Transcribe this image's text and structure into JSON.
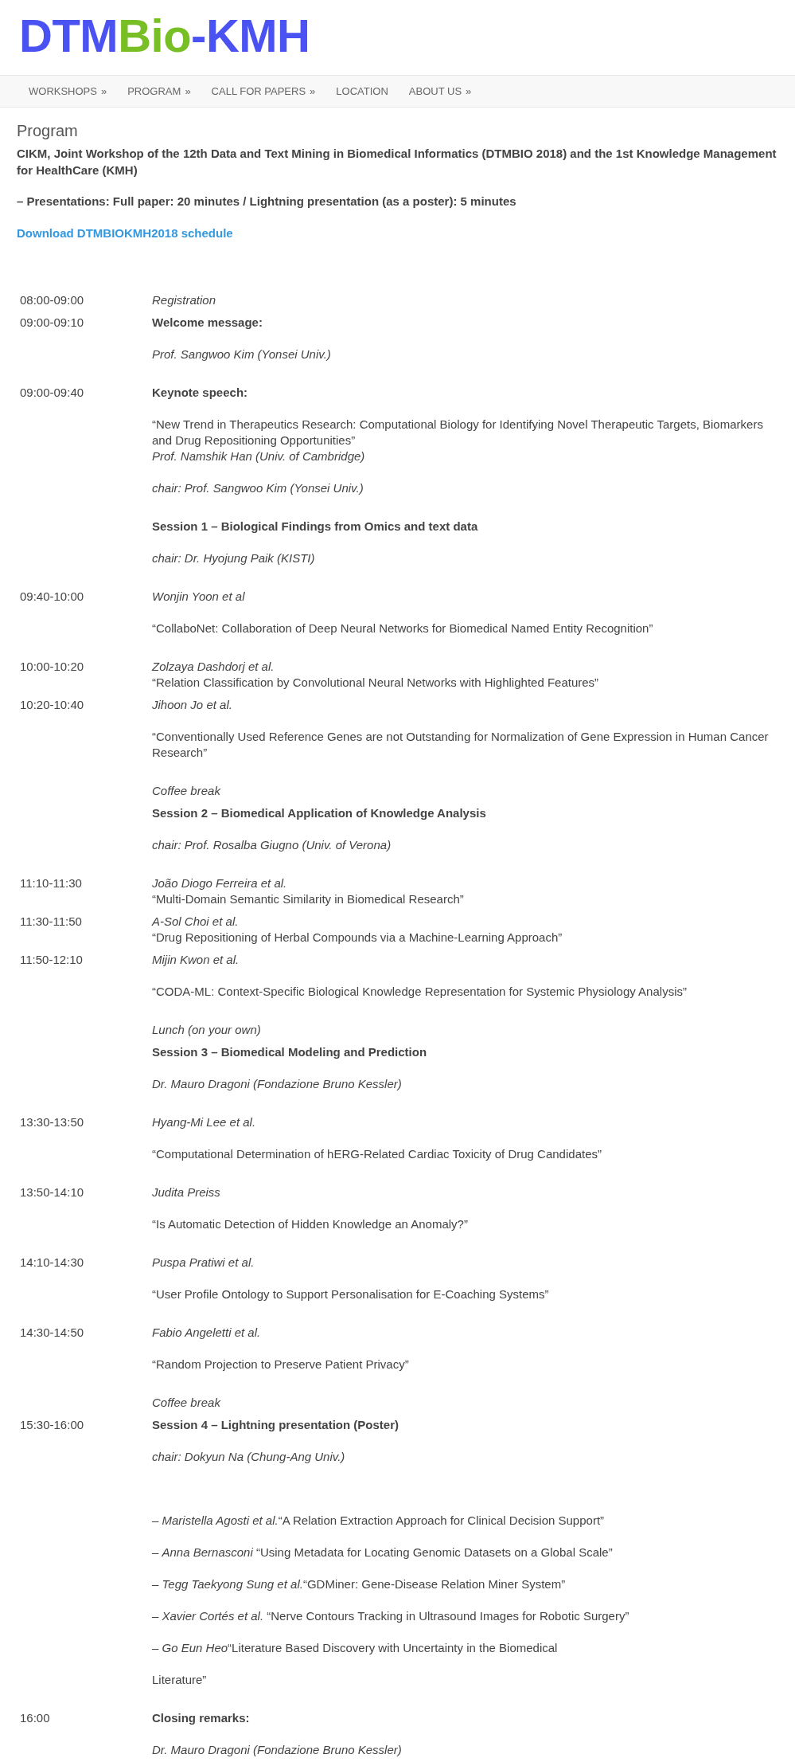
{
  "site": {
    "logo": [
      {
        "text": "DTM",
        "color": "#4a52f2"
      },
      {
        "text": "Bio",
        "color": "#78be25"
      },
      {
        "text": "-KMH",
        "color": "#4a52f2"
      }
    ]
  },
  "nav": {
    "items": [
      {
        "label": "WORKSHOPS",
        "arrow": "»"
      },
      {
        "label": "PROGRAM",
        "arrow": "»"
      },
      {
        "label": "CALL FOR PAPERS",
        "arrow": "»"
      },
      {
        "label": "LOCATION"
      },
      {
        "label": "ABOUT US",
        "arrow": "»"
      }
    ]
  },
  "page": {
    "title": "Program",
    "intro": "CIKM, Joint Workshop of the 12th Data and Text Mining in Biomedical Informatics (DTMBIO 2018) and the 1st Knowledge Management for HealthCare (KMH)",
    "note": "– Presentations: Full paper: 20 minutes / Lightning presentation (as a poster): 5 minutes",
    "download_link": "Download DTMBIOKMH2018 schedule"
  },
  "schedule": {
    "rows": [
      {
        "time": "08:00-09:00",
        "paragraphs": [
          {
            "lines": [
              {
                "kind": "note",
                "text": "Registration"
              }
            ]
          }
        ]
      },
      {
        "time": "09:00-09:10",
        "paragraphs": [
          {
            "lines": [
              {
                "kind": "heading",
                "text": "Welcome message:"
              }
            ]
          },
          {
            "lines": [
              {
                "kind": "speaker",
                "text": "Prof. Sangwoo Kim (Yonsei Univ.)"
              }
            ]
          }
        ]
      },
      {
        "time": "09:00-09:40",
        "paragraphs": [
          {
            "lines": [
              {
                "kind": "heading",
                "text": "Keynote speech:"
              }
            ]
          },
          {
            "lines": [
              {
                "kind": "paper",
                "text": "“New Trend in Therapeutics Research: Computational Biology for Identifying Novel Therapeutic Targets, Biomarkers and Drug Repositioning Opportunities”"
              },
              {
                "kind": "speaker",
                "text": "Prof. Namshik Han (Univ. of Cambridge)"
              }
            ]
          },
          {
            "lines": [
              {
                "kind": "chair",
                "text": "chair: Prof. Sangwoo Kim (Yonsei Univ.)"
              }
            ]
          }
        ]
      },
      {
        "paragraphs": [
          {
            "lines": [
              {
                "kind": "heading",
                "text": "Session 1 – Biological Findings from Omics and text data"
              }
            ]
          },
          {
            "lines": [
              {
                "kind": "chair",
                "text": "chair: Dr. Hyojung Paik (KISTI)"
              }
            ]
          }
        ]
      },
      {
        "time": "09:40-10:00",
        "paragraphs": [
          {
            "lines": [
              {
                "kind": "speaker",
                "text": "Wonjin Yoon et al"
              }
            ]
          },
          {
            "lines": [
              {
                "kind": "paper",
                "text": "“CollaboNet: Collaboration of Deep Neural Networks for Biomedical Named Entity Recognition”"
              }
            ]
          }
        ]
      },
      {
        "time": "10:00-10:20",
        "paragraphs": [
          {
            "lines": [
              {
                "kind": "speaker",
                "text": "Zolzaya Dashdorj et al."
              },
              {
                "kind": "paper",
                "text": "“Relation Classification by Convolutional Neural Networks with Highlighted Features”"
              }
            ]
          }
        ]
      },
      {
        "time": "10:20-10:40",
        "paragraphs": [
          {
            "lines": [
              {
                "kind": "speaker",
                "text": "Jihoon Jo et al."
              }
            ]
          },
          {
            "lines": [
              {
                "kind": "paper",
                "text": "“Conventionally Used Reference Genes are not Outstanding for Normalization of Gene Expression in Human Cancer Research”"
              }
            ]
          }
        ]
      },
      {
        "paragraphs": [
          {
            "lines": [
              {
                "kind": "note",
                "text": "Coffee break"
              }
            ]
          }
        ]
      },
      {
        "paragraphs": [
          {
            "lines": [
              {
                "kind": "heading",
                "text": "Session 2 – Biomedical Application of Knowledge Analysis"
              }
            ]
          },
          {
            "lines": [
              {
                "kind": "chair",
                "text": "chair: Prof. Rosalba Giugno (Univ. of Verona)"
              }
            ]
          }
        ]
      },
      {
        "time": "11:10-11:30",
        "paragraphs": [
          {
            "lines": [
              {
                "kind": "speaker",
                "text": "João Diogo Ferreira et al."
              },
              {
                "kind": "paper",
                "text": "“Multi-Domain Semantic Similarity in Biomedical Research”"
              }
            ]
          }
        ]
      },
      {
        "time": "11:30-11:50",
        "paragraphs": [
          {
            "lines": [
              {
                "kind": "speaker",
                "text": "A-Sol Choi et al."
              },
              {
                "kind": "paper",
                "text": "“Drug Repositioning of Herbal Compounds via a Machine-Learning Approach”"
              }
            ]
          }
        ]
      },
      {
        "time": "11:50-12:10",
        "paragraphs": [
          {
            "lines": [
              {
                "kind": "speaker",
                "text": "Mijin Kwon et al."
              }
            ]
          },
          {
            "lines": [
              {
                "kind": "paper",
                "text": "“CODA-ML: Context-Specific Biological Knowledge Representation for Systemic Physiology Analysis”"
              }
            ]
          }
        ]
      },
      {
        "paragraphs": [
          {
            "lines": [
              {
                "kind": "note",
                "text": "Lunch (on your own)"
              }
            ]
          }
        ]
      },
      {
        "paragraphs": [
          {
            "lines": [
              {
                "kind": "heading",
                "text": "Session 3 – Biomedical Modeling and Prediction"
              }
            ]
          },
          {
            "lines": [
              {
                "kind": "chair",
                "text": "Dr. Mauro Dragoni (Fondazione Bruno Kessler)"
              }
            ]
          }
        ]
      },
      {
        "time": "13:30-13:50",
        "paragraphs": [
          {
            "lines": [
              {
                "kind": "speaker",
                "text": "Hyang-Mi Lee et al."
              }
            ]
          },
          {
            "lines": [
              {
                "kind": "paper",
                "text": "“Computational Determination of hERG-Related Cardiac Toxicity of Drug Candidates”"
              }
            ]
          }
        ]
      },
      {
        "time": "13:50-14:10",
        "paragraphs": [
          {
            "lines": [
              {
                "kind": "speaker",
                "text": "Judita Preiss"
              }
            ]
          },
          {
            "lines": [
              {
                "kind": "paper",
                "text": "“Is Automatic Detection of Hidden Knowledge an Anomaly?”"
              }
            ]
          }
        ]
      },
      {
        "time": "14:10-14:30",
        "paragraphs": [
          {
            "lines": [
              {
                "kind": "speaker",
                "text": "Puspa Pratiwi et al."
              }
            ]
          },
          {
            "lines": [
              {
                "kind": "paper",
                "text": "“User Profile Ontology to Support Personalisation for E-Coaching Systems”"
              }
            ]
          }
        ]
      },
      {
        "time": "14:30-14:50",
        "paragraphs": [
          {
            "lines": [
              {
                "kind": "speaker",
                "text": "Fabio Angeletti et al."
              }
            ]
          },
          {
            "lines": [
              {
                "kind": "paper",
                "text": "“Random Projection to Preserve Patient Privacy”"
              }
            ]
          }
        ]
      },
      {
        "paragraphs": [
          {
            "lines": [
              {
                "kind": "note",
                "text": "Coffee break"
              }
            ]
          }
        ]
      },
      {
        "time": "15:30-16:00",
        "paragraphs": [
          {
            "lines": [
              {
                "kind": "heading",
                "text": "Session 4 – Lightning presentation (Poster)"
              }
            ]
          },
          {
            "lines": [
              {
                "kind": "chair",
                "text": "chair: Dokyun Na (Chung-Ang Univ.)"
              }
            ]
          }
        ],
        "posters": [
          "– *Maristella Agosti et al.*“A Relation Extraction Approach for Clinical Decision Support”",
          "– *Anna Bernasconi* “Using Metadata for Locating Genomic Datasets on a Global Scale”",
          "– *Tegg Taekyong Sung et al.*“GDMiner: Gene-Disease Relation Miner System”",
          "– *Xavier Cortés et al.* “Nerve Contours Tracking in Ultrasound Images for Robotic Surgery”",
          "– *Go Eun Heo*“Literature Based Discovery with Uncertainty in the Biomedical",
          "Literature”"
        ]
      },
      {
        "time": "16:00",
        "paragraphs": [
          {
            "lines": [
              {
                "kind": "heading",
                "text": "Closing remarks:"
              }
            ]
          },
          {
            "lines": [
              {
                "kind": "speaker",
                "text": "Dr. Mauro Dragoni (Fondazione Bruno Kessler)"
              }
            ]
          }
        ]
      }
    ]
  }
}
